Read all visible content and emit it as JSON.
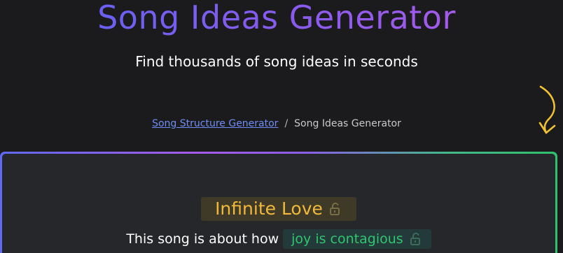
{
  "header": {
    "title": "Song Ideas Generator",
    "subtitle": "Find thousands of song ideas in seconds"
  },
  "breadcrumb": {
    "items": [
      {
        "label": "Song Structure Generator",
        "link": true
      },
      {
        "label": "Song Ideas Generator",
        "link": false
      }
    ],
    "separator": "/"
  },
  "idea_card": {
    "title": "Infinite Love",
    "title_locked": false,
    "about_prefix": "This song is about how",
    "about_value": "joy is contagious",
    "about_locked": false
  },
  "colors": {
    "title_gradient_start": "#5b63f2",
    "title_gradient_end": "#b45be8",
    "link": "#6f8df3",
    "idea_title": "#f2b83a",
    "about_value": "#2fc76e",
    "arrow": "#f2c230",
    "background": "#1b1b1d",
    "card_background": "#26272a"
  },
  "icons": {
    "arrow": "curved-arrow-down-icon",
    "lock": "unlocked-padlock-icon"
  }
}
